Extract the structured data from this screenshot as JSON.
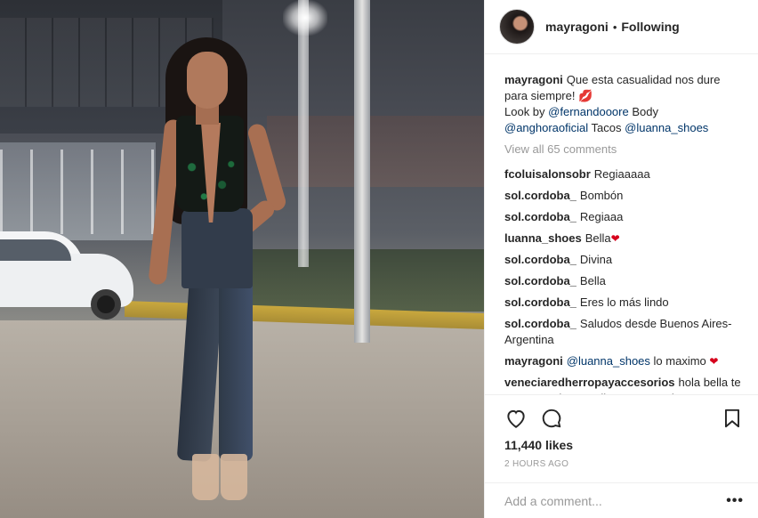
{
  "header": {
    "username": "mayragoni",
    "separator": "•",
    "follow_status": "Following"
  },
  "caption": {
    "username": "mayragoni",
    "text_1": "Que esta casualidad nos dure para siempre!",
    "emoji": "💋",
    "text_2": "Look by",
    "mention_1": "@fernandooore",
    "text_3": "Body",
    "mention_2": "@anghoraoficial",
    "text_4": "Tacos",
    "mention_3": "@luanna_shoes"
  },
  "view_all": "View all 65 comments",
  "comments": [
    {
      "user": "fcoluisalonsobr",
      "text": "Regiaaaaa"
    },
    {
      "user": "sol.cordoba_",
      "text": "Bombón"
    },
    {
      "user": "sol.cordoba_",
      "text": "Regiaaa"
    },
    {
      "user": "luanna_shoes",
      "text": "Bella",
      "emoji": "❤"
    },
    {
      "user": "sol.cordoba_",
      "text": "Divina"
    },
    {
      "user": "sol.cordoba_",
      "text": "Bella"
    },
    {
      "user": "sol.cordoba_",
      "text": "Eres lo más lindo"
    },
    {
      "user": "sol.cordoba_",
      "text": "Saludos desde Buenos Aires- Argentina"
    },
    {
      "user": "mayragoni",
      "mention": "@luanna_shoes",
      "text": "lo maximo",
      "emoji": "❤"
    },
    {
      "user": "veneciaredherropayaccesorios",
      "text": "hola bella te queremos hacerte llegar un regalo"
    }
  ],
  "actions": {
    "likes": "11,440 likes",
    "time": "2 HOURS AGO",
    "add_comment_placeholder": "Add a comment...",
    "more": "•••"
  },
  "icons": {
    "like": "heart-outline",
    "comment": "speech-bubble",
    "save": "bookmark"
  }
}
